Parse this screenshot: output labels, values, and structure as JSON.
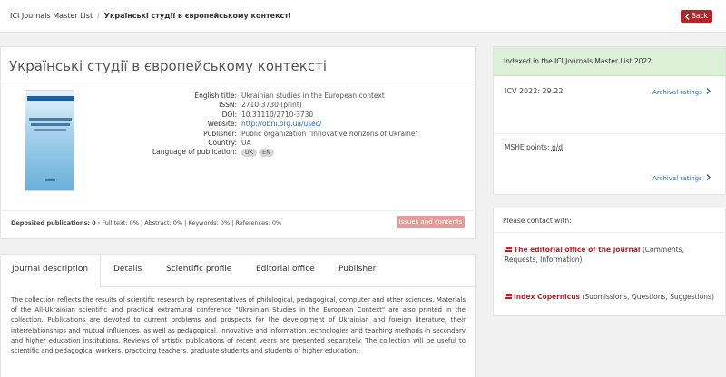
{
  "breadcrumb": {
    "root": "ICI Journals Master List",
    "separator": "/",
    "current": "Українські студії в європейському контексті"
  },
  "back_button": {
    "icon": "chevron-left-icon",
    "label": "Back"
  },
  "journal": {
    "title": "Українські студії в європейському контексті",
    "fields": [
      {
        "label": "English title:",
        "value": "Ukrainian studies in the European context"
      },
      {
        "label": "ISSN:",
        "value": "2710-3730 (print)"
      },
      {
        "label": "DOI:",
        "value": "10.31110/2710-3730"
      },
      {
        "label": "Website:",
        "value": "http://obrii.org.ua/usec/"
      },
      {
        "label": "Publisher:",
        "value": "Public organization \"Innovative horizons of Ukraine\""
      },
      {
        "label": "Country:",
        "value": "UA"
      }
    ],
    "language_label": "Language of publication:",
    "languages": [
      "UK",
      "EN"
    ]
  },
  "deposited": {
    "label": "Deposited publications:",
    "count": "0",
    "details": " › Full text: 0% | Abstract: 0% | Keywords: 0% | References: 0%"
  },
  "issues_button": "Issues and contents",
  "tabs": [
    "Journal description",
    "Details",
    "Scientific profile",
    "Editorial office",
    "Publisher"
  ],
  "description": "The collection reflects the results of scientific research by representatives of philological, pedagogical, computer and other sciences. Materials of the All-Ukrainian scientific and practical extramural conference \"Ukrainian Studies in the European Context\" are also printed in the collection. Publications are devoted to current problems and prospects for the development of Ukrainian and foreign literature, their interrelationships and mutual influences, as well as pedagogical, innovative and information technologies and teaching methods in secondary and higher education institutions. Reviews of artistic publications of recent years are presented separately. The collection will be useful to scientific and pedagogical workers, practicing teachers, graduate students and students of higher education.",
  "indexing": {
    "header": "Indexed in the ICI Journals Master List 2022",
    "icv": "ICV 2022: 29.22",
    "archival_label": "Archival ratings",
    "mshe_label": "MSHE points:",
    "mshe_value": "n/d"
  },
  "contact": {
    "header": "Please contact with:",
    "items": [
      {
        "name": "The editorial office of the journal",
        "note": " (Comments, Requests, Information)"
      },
      {
        "name": "Index Copernicus",
        "note": " (Submissions, Questions, Suggestions)"
      }
    ]
  },
  "colors": {
    "accent": "#b0262a",
    "link": "#2a69a6",
    "indexed_bg": "#dbf0d6"
  }
}
